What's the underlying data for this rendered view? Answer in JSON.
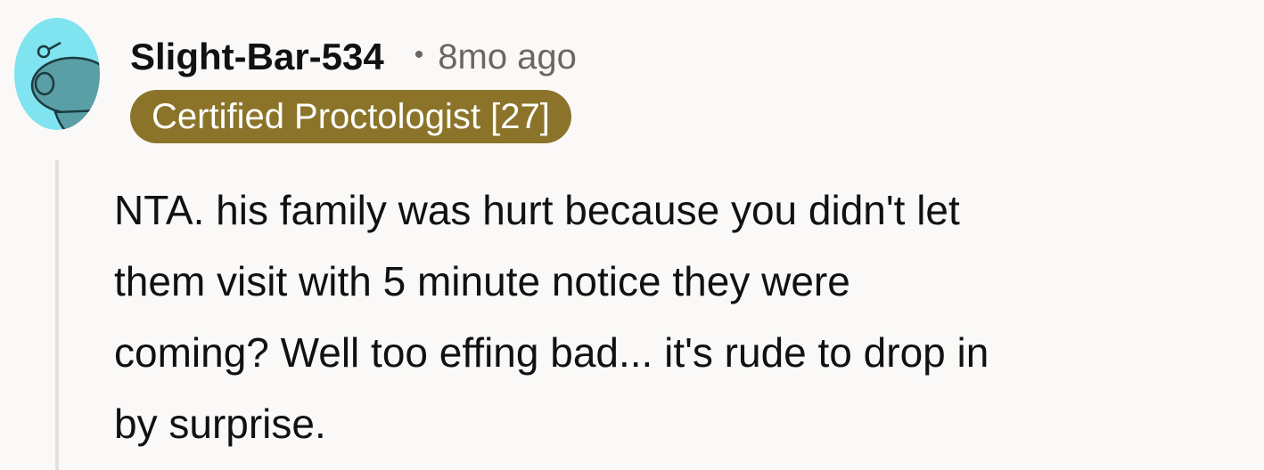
{
  "comment": {
    "avatar_icon": "snoo-avatar-icon",
    "username": "Slight-Bar-534",
    "separator": "•",
    "timestamp": "8mo ago",
    "flair": "Certified Proctologist [27]",
    "body_lines": [
      "NTA. his family was hurt because you didn't let",
      "them visit with 5 minute notice they were",
      "coming? Well too effing bad... it's rude to drop in",
      "by surprise."
    ]
  },
  "colors": {
    "background": "#fbf9f8",
    "avatar_bg": "#7fe3f0",
    "snoo_body": "#5a9ea6",
    "flair_bg": "#8b742a",
    "flair_text": "#ffffff",
    "meta_text": "#6b6764",
    "thread_line": "#e3e1df"
  }
}
